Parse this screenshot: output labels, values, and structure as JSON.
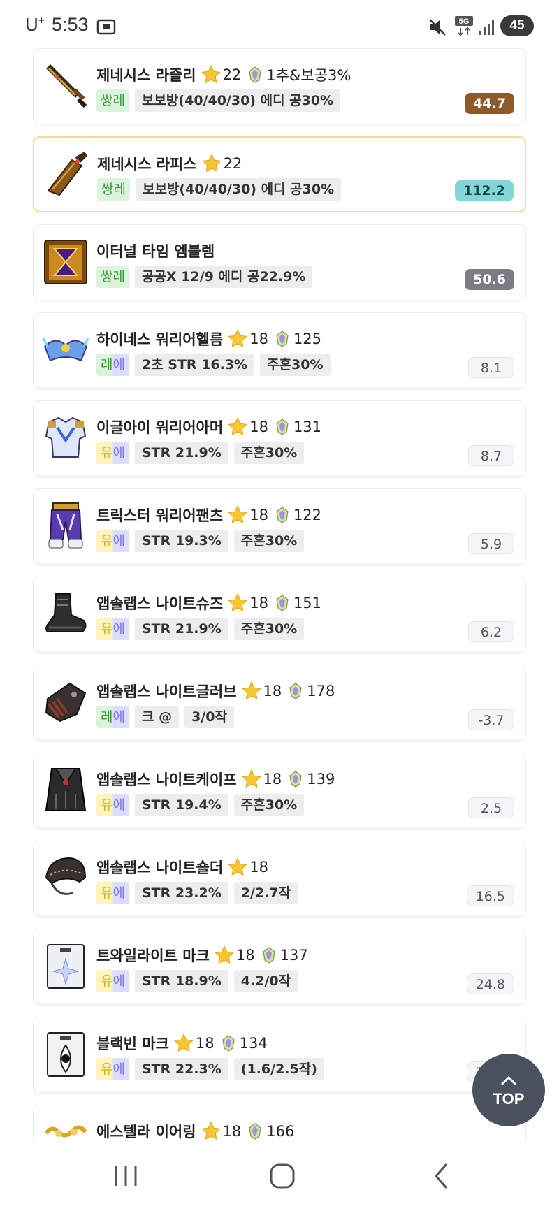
{
  "status_bar": {
    "carrier": "U",
    "carrier_sup": "+",
    "time": "5:53",
    "network": "5G",
    "battery": "45",
    "icons": [
      "screenshot-icon",
      "mute-icon",
      "network-5g-icon",
      "signal-icon",
      "battery-icon"
    ]
  },
  "colors": {
    "legendary": "#3c9a3c",
    "unique": "#d8b000",
    "epic": "#7b7bdb",
    "score_brown": "#8e5a2c",
    "score_teal": "#83d6d6",
    "score_gray": "#7a7c86",
    "selected_border": "#f2df8a"
  },
  "items": [
    {
      "name": "제네시스 라즐리",
      "stars": "22",
      "flame": "1추&보공3%",
      "pot_a": "쌍레",
      "options": [
        "보보방(40/40/30) 에디 공30%"
      ],
      "score": "44.7",
      "icon": "genesis-sword-icon"
    },
    {
      "name": "제네시스 라피스",
      "stars": "22",
      "pot_a": "쌍레",
      "options": [
        "보보방(40/40/30) 에디 공30%"
      ],
      "score": "112.2",
      "icon": "genesis-lapis-icon"
    },
    {
      "name": "이터널 타임 엠블렘",
      "pot_a": "쌍레",
      "options": [
        "공공X 12/9 에디 공22.9%"
      ],
      "score": "50.6",
      "icon": "emblem-icon"
    },
    {
      "name": "하이네스 워리어헬름",
      "stars": "18",
      "flame": "125",
      "pot_a": "레",
      "pot_b": "에",
      "options": [
        "2초 STR 16.3%",
        "주흔30%"
      ],
      "score": "8.1",
      "icon": "helmet-icon"
    },
    {
      "name": "이글아이 워리어아머",
      "stars": "18",
      "flame": "131",
      "pot_a": "유",
      "pot_b": "에",
      "options": [
        "STR 21.9%",
        "주흔30%"
      ],
      "score": "8.7",
      "icon": "armor-icon"
    },
    {
      "name": "트릭스터 워리어팬츠",
      "stars": "18",
      "flame": "122",
      "pot_a": "유",
      "pot_b": "에",
      "options": [
        "STR 19.3%",
        "주흔30%"
      ],
      "score": "5.9",
      "icon": "pants-icon"
    },
    {
      "name": "앱솔랩스 나이트슈즈",
      "stars": "18",
      "flame": "151",
      "pot_a": "유",
      "pot_b": "에",
      "options": [
        "STR 21.9%",
        "주흔30%"
      ],
      "score": "6.2",
      "icon": "shoes-icon"
    },
    {
      "name": "앱솔랩스 나이트글러브",
      "stars": "18",
      "flame": "178",
      "pot_a": "레",
      "pot_b": "에",
      "options": [
        "크 @",
        "3/0작"
      ],
      "score": "-3.7",
      "icon": "glove-icon"
    },
    {
      "name": "앱솔랩스 나이트케이프",
      "stars": "18",
      "flame": "139",
      "pot_a": "유",
      "pot_b": "에",
      "options": [
        "STR 19.4%",
        "주흔30%"
      ],
      "score": "2.5",
      "icon": "cape-icon"
    },
    {
      "name": "앱솔랩스 나이트숄더",
      "stars": "18",
      "pot_a": "유",
      "pot_b": "에",
      "options": [
        "STR 23.2%",
        "2/2.7작"
      ],
      "score": "16.5",
      "icon": "shoulder-icon"
    },
    {
      "name": "트와일라이트 마크",
      "stars": "18",
      "flame": "137",
      "pot_a": "유",
      "pot_b": "에",
      "options": [
        "STR 18.9%",
        "4.2/0작"
      ],
      "score": "24.8",
      "icon": "twilight-mark-icon"
    },
    {
      "name": "블랙빈 마크",
      "stars": "18",
      "flame": "134",
      "pot_a": "유",
      "pot_b": "에",
      "options": [
        "STR 22.3%",
        "(1.6/2.5작)"
      ],
      "score": "24.3",
      "icon": "blackbean-mark-icon"
    },
    {
      "name": "에스텔라 이어링",
      "stars": "18",
      "flame": "166",
      "icon": "earring-icon"
    }
  ],
  "top_button": {
    "label": "TOP"
  },
  "nav_bar": {
    "buttons": [
      "recent-apps-icon",
      "home-icon",
      "back-icon"
    ]
  }
}
